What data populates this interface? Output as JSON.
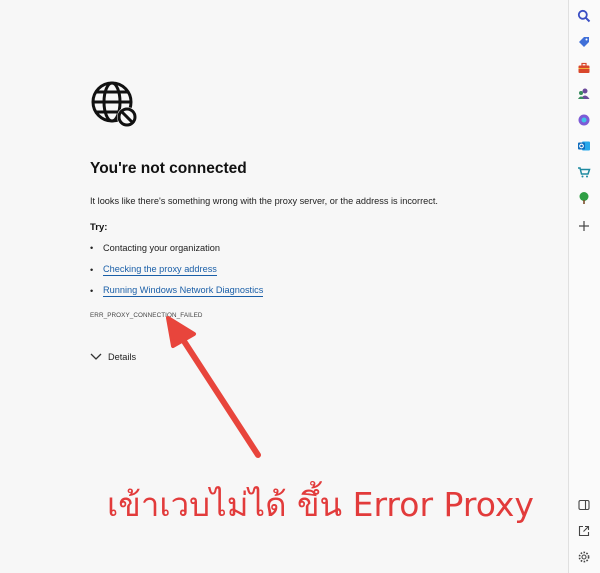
{
  "error_page": {
    "title": "You're not connected",
    "description": "It looks like there's something wrong with the proxy server, or the address is incorrect.",
    "try_label": "Try:",
    "suggestions": [
      {
        "label": "Contacting your organization",
        "link": false
      },
      {
        "label": "Checking the proxy address",
        "link": true
      },
      {
        "label": "Running Windows Network Diagnostics",
        "link": true
      }
    ],
    "error_code": "ERR_PROXY_CONNECTION_FAILED",
    "details_label": "Details"
  },
  "annotation": {
    "text": "เข้าเวบไม่ได้ ขึ้น Error Proxy",
    "color": "#e23b3b"
  },
  "sidebar": {
    "icons": [
      "search-icon",
      "tag-icon",
      "toolbox-icon",
      "people-icon",
      "copilot-icon",
      "outlook-icon",
      "shopping-cart-icon",
      "tree-icon",
      "add-icon",
      "split-screen-icon",
      "external-link-icon",
      "gear-icon"
    ]
  },
  "colors": {
    "link": "#1a5fa8",
    "page_background": "#f7f7f7"
  }
}
